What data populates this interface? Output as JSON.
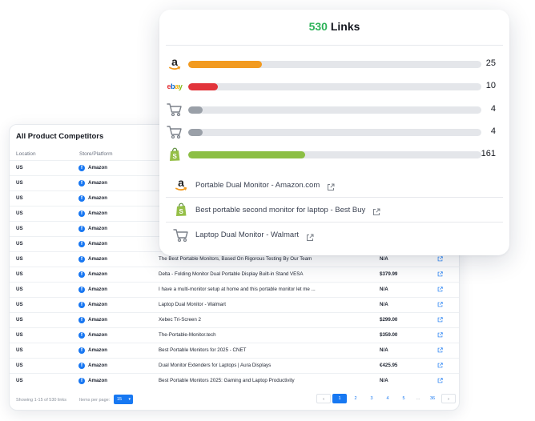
{
  "table": {
    "title": "All Product Competitors",
    "columns": {
      "location": "Location",
      "store": "Store/Platform"
    },
    "rows": [
      {
        "location": "US",
        "store": "Amazon",
        "product": "",
        "price": ""
      },
      {
        "location": "US",
        "store": "Amazon",
        "product": "",
        "price": ""
      },
      {
        "location": "US",
        "store": "Amazon",
        "product": "",
        "price": ""
      },
      {
        "location": "US",
        "store": "Amazon",
        "product": "",
        "price": ""
      },
      {
        "location": "US",
        "store": "Amazon",
        "product": "",
        "price": ""
      },
      {
        "location": "US",
        "store": "Amazon",
        "product": "",
        "price": ""
      },
      {
        "location": "US",
        "store": "Amazon",
        "product": "The Best Portable Monitors, Based On Rigorous Testing By Our Team",
        "price": "N/A"
      },
      {
        "location": "US",
        "store": "Amazon",
        "product": "Delta - Folding Monitor Dual Portable Display Built-in Stand VESA",
        "price": "$379.99"
      },
      {
        "location": "US",
        "store": "Amazon",
        "product": "I have a multi-monitor setup at home and this portable monitor let me ...",
        "price": "N/A"
      },
      {
        "location": "US",
        "store": "Amazon",
        "product": "Laptop Dual Monitor - Walmart",
        "price": "N/A"
      },
      {
        "location": "US",
        "store": "Amazon",
        "product": "Xebec Tri-Screen 2",
        "price": "$299.00"
      },
      {
        "location": "US",
        "store": "Amazon",
        "product": "The-Portable-Monitor.tech",
        "price": "$359.00"
      },
      {
        "location": "US",
        "store": "Amazon",
        "product": "Best Portable Monitors for 2025 - CNET",
        "price": "N/A"
      },
      {
        "location": "US",
        "store": "Amazon",
        "product": "Dual Monitor Extenders for Laptops | Aura Displays",
        "price": "€425.95"
      },
      {
        "location": "US",
        "store": "Amazon",
        "product": "Best Portable Monitors 2025: Gaming and Laptop Productivity",
        "price": "N/A"
      }
    ],
    "footer": {
      "showing": "Showing 1-15 of 530 links",
      "items_per_page_label": "Items per page:",
      "items_per_page_value": "15",
      "pages": [
        "1",
        "2",
        "3",
        "4",
        "5",
        "...",
        "36"
      ],
      "active_page": "1",
      "prev": "‹",
      "next": "›"
    }
  },
  "links_card": {
    "count": "530",
    "title_suffix": "Links",
    "bars": [
      {
        "icon": "amazon-icon",
        "value": 25,
        "fill_fraction": 0.25,
        "color": "#f29a1f"
      },
      {
        "icon": "ebay-icon",
        "value": 10,
        "fill_fraction": 0.1,
        "color": "#e2343b"
      },
      {
        "icon": "cart-icon",
        "value": 4,
        "fill_fraction": 0.05,
        "color": "#9aa0a8"
      },
      {
        "icon": "cart-icon",
        "value": 4,
        "fill_fraction": 0.05,
        "color": "#9aa0a8"
      },
      {
        "icon": "shopify-icon",
        "value": 161,
        "fill_fraction": 0.4,
        "color": "#8cbf44"
      }
    ],
    "links": [
      {
        "icon": "amazon-icon",
        "label": "Portable Dual Monitor - Amazon.com"
      },
      {
        "icon": "shopify-icon",
        "label": "Best portable second monitor for laptop - Best Buy"
      },
      {
        "icon": "cart-icon",
        "label": "Laptop Dual Monitor - Walmart"
      }
    ]
  },
  "colors": {
    "accent": "#1778f2",
    "green": "#2fb35a",
    "facebook": "#1877f2"
  }
}
